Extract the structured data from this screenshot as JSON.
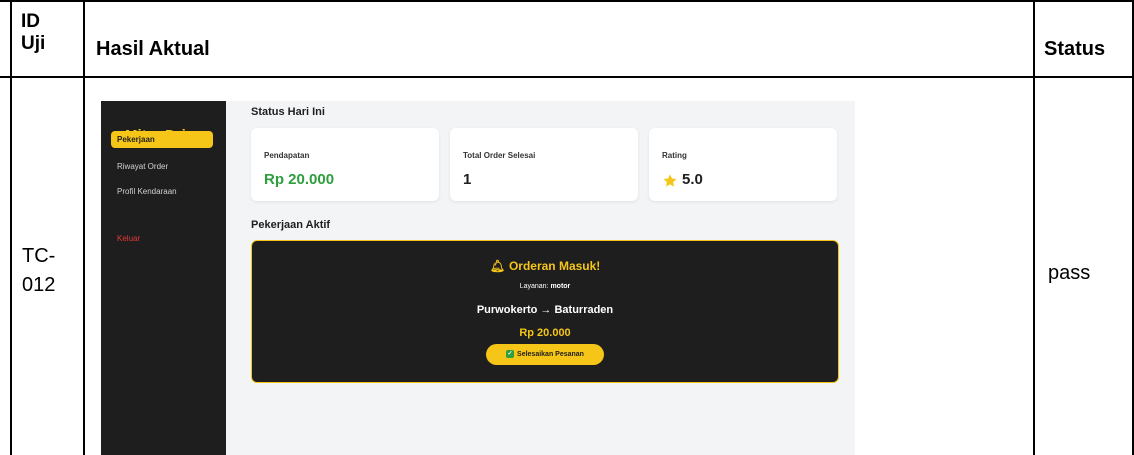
{
  "table": {
    "headers": {
      "id_line1": "ID",
      "id_line2": "Uji",
      "result": "Hasil Aktual",
      "status": "Status"
    },
    "row": {
      "id_line1": "TC-",
      "id_line2": "012",
      "status": "pass"
    }
  },
  "app": {
    "brand": "Mitra Driver",
    "nav": {
      "active": "Pekerjaan",
      "history": "Riwayat Order",
      "vehicle": "Profil Kendaraan",
      "logout": "Keluar"
    },
    "status_section": "Status Hari Ini",
    "cards": {
      "income": {
        "label": "Pendapatan",
        "value": "Rp 20.000"
      },
      "orders": {
        "label": "Total Order Selesai",
        "value": "1"
      },
      "rating": {
        "label": "Rating",
        "value": "5.0",
        "icon": "star-icon"
      }
    },
    "active_section": "Pekerjaan Aktif",
    "order": {
      "title": "Orderan Masuk!",
      "title_icon": "bell-icon",
      "service_label": "Layanan:",
      "service_value": "motor",
      "route": "Purwokerto → Baturraden",
      "price": "Rp 20.000",
      "finish_button": "Selesaikan Pesanan",
      "finish_icon": "check-icon"
    },
    "colors": {
      "accent": "#f5c518",
      "dark": "#1e1e1e",
      "green": "#2e9e3e",
      "danger": "#e53935"
    }
  }
}
